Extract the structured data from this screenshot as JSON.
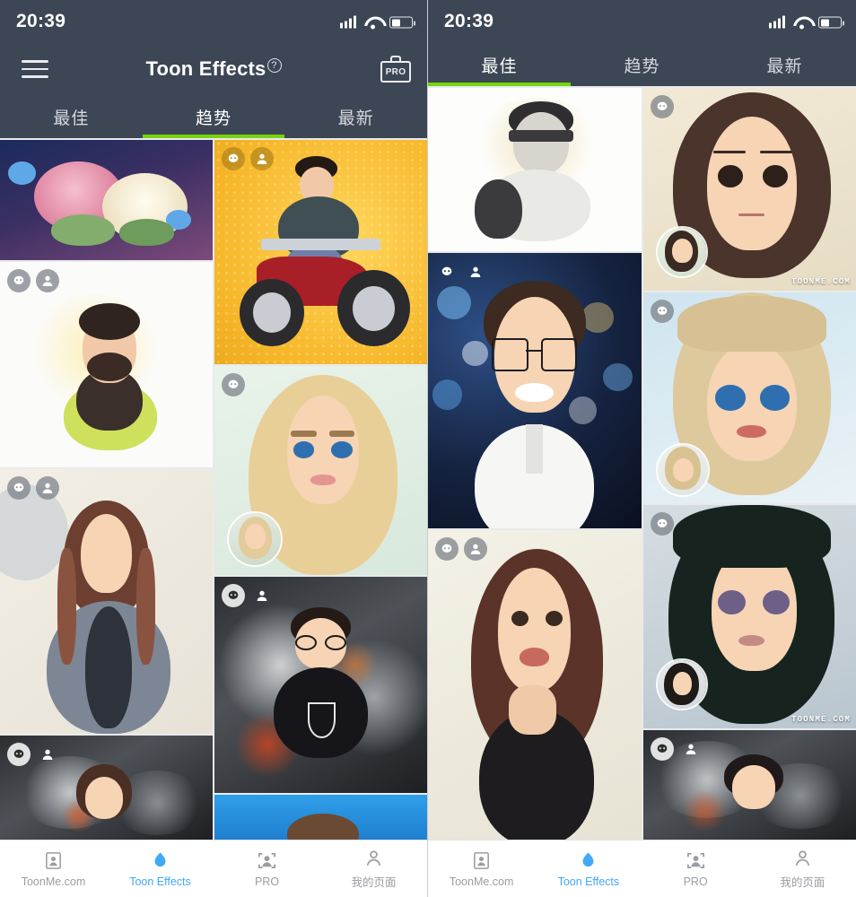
{
  "app": {
    "name": "ToonMe",
    "accent_green": "#76d40f",
    "accent_blue": "#41a9f5",
    "header_bg": "#3d4654"
  },
  "status_bar": {
    "time": "20:39",
    "signal_icon": "signal-bars-icon",
    "wifi_icon": "wifi-icon",
    "battery_icon": "battery-icon"
  },
  "left_panel": {
    "app_bar": {
      "menu_icon": "hamburger-menu-icon",
      "title": "Toon Effects",
      "help_badge": "?",
      "pro_button_label": "PRO",
      "pro_icon": "briefcase-pro-icon"
    },
    "tabs": [
      {
        "label": "最佳",
        "active": false
      },
      {
        "label": "趋势",
        "active": true
      },
      {
        "label": "最新",
        "active": false
      }
    ],
    "active_tab_index": 1,
    "tiles": [
      {
        "id": "l1",
        "art": "flowers-roses",
        "badges": [],
        "watermark": null
      },
      {
        "id": "l2",
        "art": "bearded-man-yellow",
        "badges": [
          "toon-face-icon",
          "person-icon"
        ],
        "watermark": null
      },
      {
        "id": "l3",
        "art": "woman-grey-coat",
        "badges": [
          "toon-face-icon",
          "person-icon"
        ],
        "watermark": null
      },
      {
        "id": "l4",
        "art": "man-smoke-dark",
        "badges": [
          "toon-face-icon",
          "person-icon"
        ],
        "watermark": null
      },
      {
        "id": "r1",
        "art": "man-on-motorcycle",
        "badges": [
          "toon-face-icon",
          "person-icon"
        ],
        "watermark": null
      },
      {
        "id": "r2",
        "art": "blonde-cartoon-woman",
        "badges": [
          "toon-face-icon"
        ],
        "watermark": null
      },
      {
        "id": "r3",
        "art": "boy-glasses-smoke",
        "badges": [
          "toon-face-icon",
          "person-icon"
        ],
        "watermark": null
      },
      {
        "id": "r4",
        "art": "blue-tile-partial",
        "badges": [],
        "watermark": null
      }
    ]
  },
  "right_panel": {
    "tabs": [
      {
        "label": "最佳",
        "active": true
      },
      {
        "label": "趋势",
        "active": false
      },
      {
        "label": "最新",
        "active": false
      }
    ],
    "active_tab_index": 0,
    "tiles": [
      {
        "id": "rl1",
        "art": "sketch-man-sunglasses",
        "badges": [],
        "watermark": null
      },
      {
        "id": "rl2",
        "art": "man-glasses-bokeh",
        "badges": [
          "toon-face-icon",
          "person-icon"
        ],
        "watermark": null
      },
      {
        "id": "rl3",
        "art": "smiling-woman-portrait",
        "badges": [
          "toon-face-icon",
          "person-icon"
        ],
        "watermark": null
      },
      {
        "id": "rr1",
        "art": "anime-woman-brown-hair",
        "badges": [
          "toon-face-icon"
        ],
        "watermark": "TOONME.COM"
      },
      {
        "id": "rr2",
        "art": "anime-blonde-bangs",
        "badges": [
          "toon-face-icon"
        ],
        "watermark": null
      },
      {
        "id": "rr3",
        "art": "anime-black-hair",
        "badges": [
          "toon-face-icon"
        ],
        "watermark": "TOONME.COM"
      },
      {
        "id": "rr4",
        "art": "man-smoke-dark-2",
        "badges": [
          "toon-face-icon",
          "person-icon"
        ],
        "watermark": null
      }
    ]
  },
  "bottom_nav": [
    {
      "label": "ToonMe.com",
      "icon": "photo-portrait-icon",
      "active": false
    },
    {
      "label": "Toon Effects",
      "icon": "flame-icon",
      "active": true
    },
    {
      "label": "PRO",
      "icon": "face-scan-icon",
      "active": false
    },
    {
      "label": "我的页面",
      "icon": "person-outline-icon",
      "active": false
    }
  ]
}
